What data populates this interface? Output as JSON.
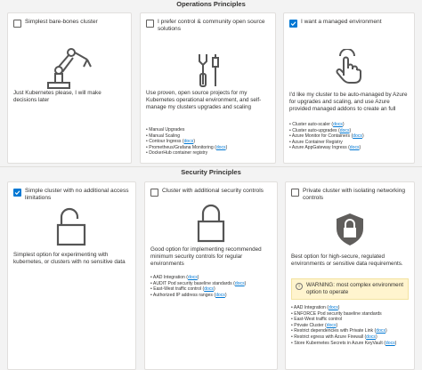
{
  "operations": {
    "heading": "Operations Principles",
    "cards": [
      {
        "title": "Simplest bare-bones cluster",
        "checked": false,
        "icon": "robot-arm-icon",
        "description": "Just Kubernetes please, I will make decisions later",
        "items": []
      },
      {
        "title": "I prefer control & community open source solutions",
        "checked": false,
        "icon": "tools-icon",
        "description": "Use proven, open source projects for my Kubernetes operational environment, and self-manage my clusters upgrades and scaling",
        "items": [
          {
            "text": "Manual Upgrades",
            "link": ""
          },
          {
            "text": "Manual Scaling",
            "link": ""
          },
          {
            "text": "Contour Ingress",
            "link": "docs"
          },
          {
            "text": "Prometheus/Grafana Monitoring",
            "link": "docs"
          },
          {
            "text": "DockerHub container registry",
            "link": ""
          }
        ]
      },
      {
        "title": "I want a managed environment",
        "checked": true,
        "icon": "hand-pointer-icon",
        "description": "I'd like my cluster to be auto-managed by Azure for upgrades and scaling, and use Azure provided managed addons to create an full",
        "items": [
          {
            "text": "Cluster auto-scaler",
            "link": "docs"
          },
          {
            "text": "Cluster auto-upgrades",
            "link": "docs"
          },
          {
            "text": "Azure Monitor for Containers",
            "link": "docs"
          },
          {
            "text": "Azure Container Registry",
            "link": ""
          },
          {
            "text": "Azure AppGateway Ingress",
            "link": "docs"
          }
        ]
      }
    ]
  },
  "security": {
    "heading": "Security Principles",
    "cards": [
      {
        "title": "Simple cluster with no additional access limitations",
        "checked": true,
        "icon": "unlocked-padlock-icon",
        "description": "Simplest option for experimenting with kubernetes, or clusters with no sensitive data",
        "items": []
      },
      {
        "title": "Cluster with additional security controls",
        "checked": false,
        "icon": "locked-padlock-icon",
        "description": "Good option for implementing recommended minimum security controls for regular environments",
        "items": [
          {
            "text": "AAD Integration",
            "link": "docs"
          },
          {
            "text": "AUDIT Pod security baseline standards",
            "link": "docs"
          },
          {
            "text": "East-West traffic control",
            "link": "docs"
          },
          {
            "text": "Authorized IP address ranges",
            "link": "docs"
          }
        ]
      },
      {
        "title": "Private cluster with isolating networking controls",
        "checked": false,
        "icon": "shield-lock-icon",
        "description": "Best option for high-secure, regulated environments or sensitive data requirements.",
        "warning": "WARNING: most complex environment option to operate",
        "items": [
          {
            "text": "AAD Integration",
            "link": "docs"
          },
          {
            "text": "ENFORCE Pod security baseline standards",
            "link": ""
          },
          {
            "text": "East-West traffic control",
            "link": ""
          },
          {
            "text": "Private Cluster",
            "link": "docs"
          },
          {
            "text": "Restrict dependencies with Private Link",
            "link": "docs"
          },
          {
            "text": "Restrict egress with Azure Firewall",
            "link": "docs"
          },
          {
            "text": "Store Kubernetes Secrets in Azure KeyVault",
            "link": "docs"
          }
        ]
      }
    ]
  },
  "colors": {
    "accent": "#0078d4",
    "warning_bg": "#fff4ce",
    "card_border": "#e1dfdd"
  }
}
